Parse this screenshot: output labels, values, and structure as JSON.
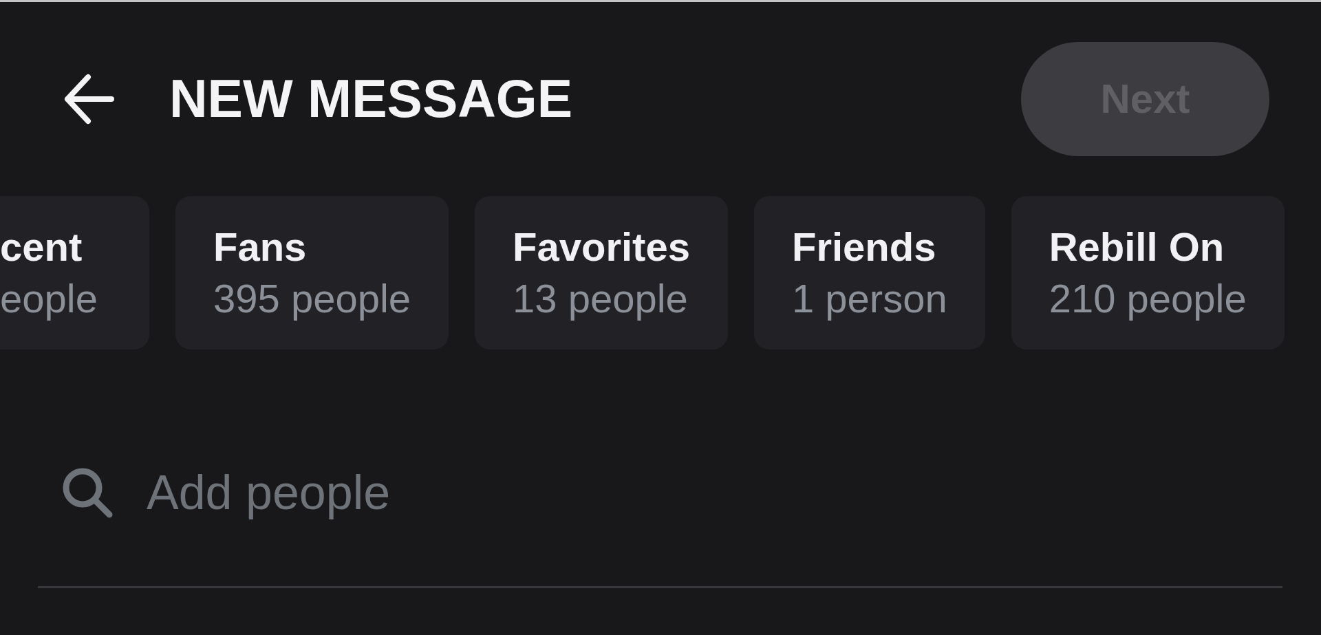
{
  "header": {
    "title": "NEW MESSAGE",
    "next_button": {
      "label": "Next",
      "disabled": true
    }
  },
  "lists": [
    {
      "name": "cent",
      "count": "eople",
      "selected": false
    },
    {
      "name": "Fans",
      "count": "395 people",
      "selected": false
    },
    {
      "name": "Favorites",
      "count": "13 people",
      "selected": false
    },
    {
      "name": "Friends",
      "count": "1 person",
      "selected": false
    },
    {
      "name": "Rebill On",
      "count": "210 people",
      "selected": false
    }
  ],
  "search": {
    "placeholder": "Add people"
  }
}
